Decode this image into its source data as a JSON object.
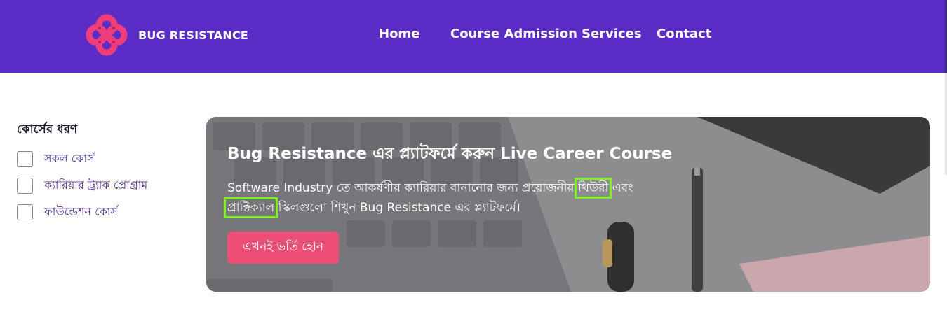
{
  "brand": {
    "name": "BUG RESISTANCE",
    "logo_icon": "interlocking-rings-logo-icon",
    "logo_color": "#ee3d78"
  },
  "nav": {
    "background": "#5b2cc6",
    "items": [
      {
        "label": "Home"
      },
      {
        "label": "Course Admission"
      },
      {
        "label": "Services"
      },
      {
        "label": "Contact"
      }
    ]
  },
  "filters": {
    "title": "কোর্সের ধরণ",
    "options": [
      {
        "label": "সকল কোর্স",
        "checked": false
      },
      {
        "label": "ক্যারিয়ার ট্র্যাক প্রোগ্রাম",
        "checked": false
      },
      {
        "label": "ফাউন্ডেশন কোর্স",
        "checked": false
      }
    ]
  },
  "hero": {
    "title": "Bug Resistance এর প্ল্যাটফর্মে করুন Live Career Course",
    "desc_part1": "Software Industry তে আকর্ষণীয় ক্যারিয়ার বানানোর জন্য প্রয়োজনীয় ",
    "desc_highlight1": "থিউরী",
    "desc_part2": " এবং ",
    "desc_highlight2": "প্রাক্টিক্যাল",
    "desc_part3": " স্কিলগুলো শিখুন Bug Resistance এর প্ল্যাটফর্মে।",
    "cta_label": "এখনই ভর্তি হোন",
    "cta_color": "#ee4f76",
    "highlight_color": "#7ef027"
  }
}
